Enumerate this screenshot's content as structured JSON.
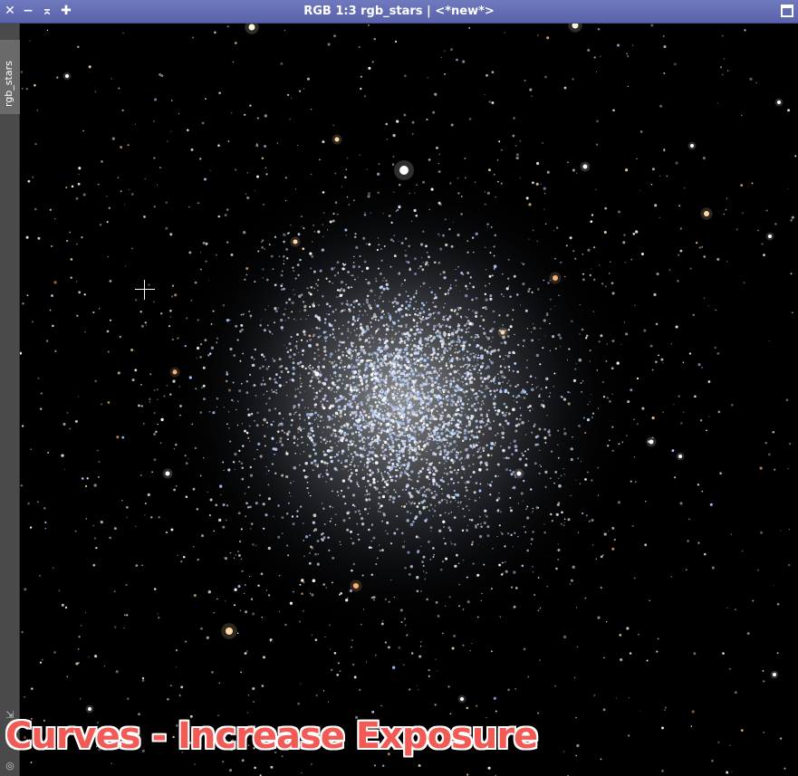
{
  "window": {
    "title": "RGB 1:3 rgb_stars | <*new*>",
    "close_glyph": "✕",
    "minimize_glyph": "−",
    "shade_glyph": "⌅",
    "add_glyph": "✚"
  },
  "sidebar": {
    "tab_label": "rgb_stars",
    "resize_glyph": "⇲",
    "target_glyph": "◎"
  },
  "image": {
    "subject": "globular star cluster",
    "background_color": "#000000"
  },
  "overlay": {
    "caption": "Curves - Increase Exposure",
    "caption_color": "#f25a55"
  },
  "colors": {
    "titlebar": "#5f68b1",
    "sidebar": "#4a4a4a"
  }
}
